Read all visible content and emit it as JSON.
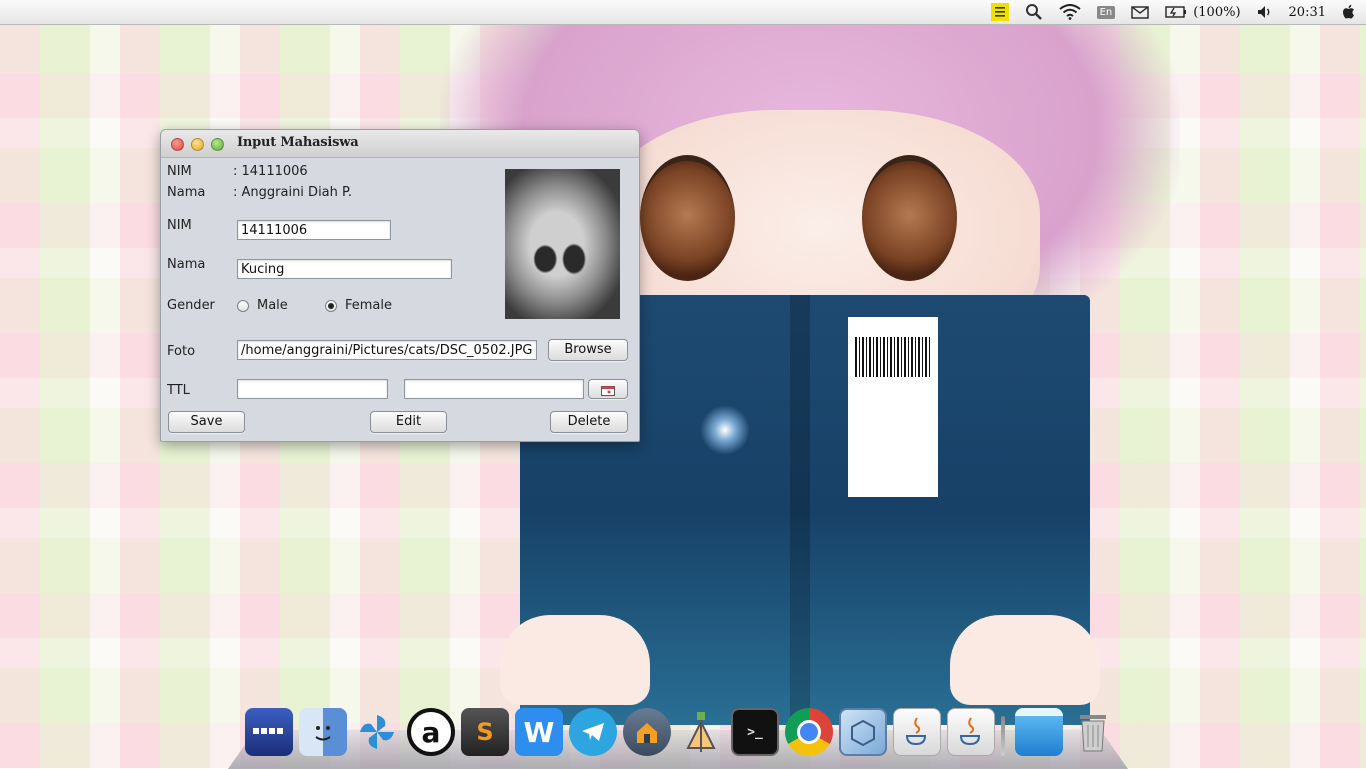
{
  "menubar": {
    "battery": "(100%)",
    "time": "20:31",
    "lang": "En",
    "icons": [
      "notes-icon",
      "search-icon",
      "wifi-icon",
      "keyboard-layout-icon",
      "mail-icon",
      "battery-icon",
      "volume-icon",
      "apple-icon"
    ]
  },
  "window": {
    "title": "Input Mahasiswa",
    "summary": {
      "nim_label": "NIM",
      "nim_value": ": 14111006",
      "nama_label": "Nama",
      "nama_value": ": Anggraini Diah P."
    },
    "form": {
      "nim_label": "NIM",
      "nim_value": "14111006",
      "nama_label": "Nama",
      "nama_value": "Kucing",
      "gender_label": "Gender",
      "gender_options": [
        "Male",
        "Female"
      ],
      "gender_selected": "Female",
      "foto_label": "Foto",
      "foto_path": "/home/anggraini/Pictures/cats/DSC_0502.JPG",
      "browse_label": "Browse",
      "ttl_label": "TTL",
      "ttl_place": "",
      "ttl_date": ""
    },
    "buttons": {
      "save": "Save",
      "edit": "Edit",
      "delete": "Delete"
    }
  },
  "dock": {
    "apps": [
      "Workspaces",
      "Finder",
      "Shotwell",
      "Amarok",
      "Sublime Text",
      "WPS Writer",
      "Telegram",
      "Home",
      "Inkscape",
      "Terminal",
      "Chrome",
      "VirtualBox",
      "Java",
      "Java",
      "Desktop",
      "Trash"
    ]
  }
}
